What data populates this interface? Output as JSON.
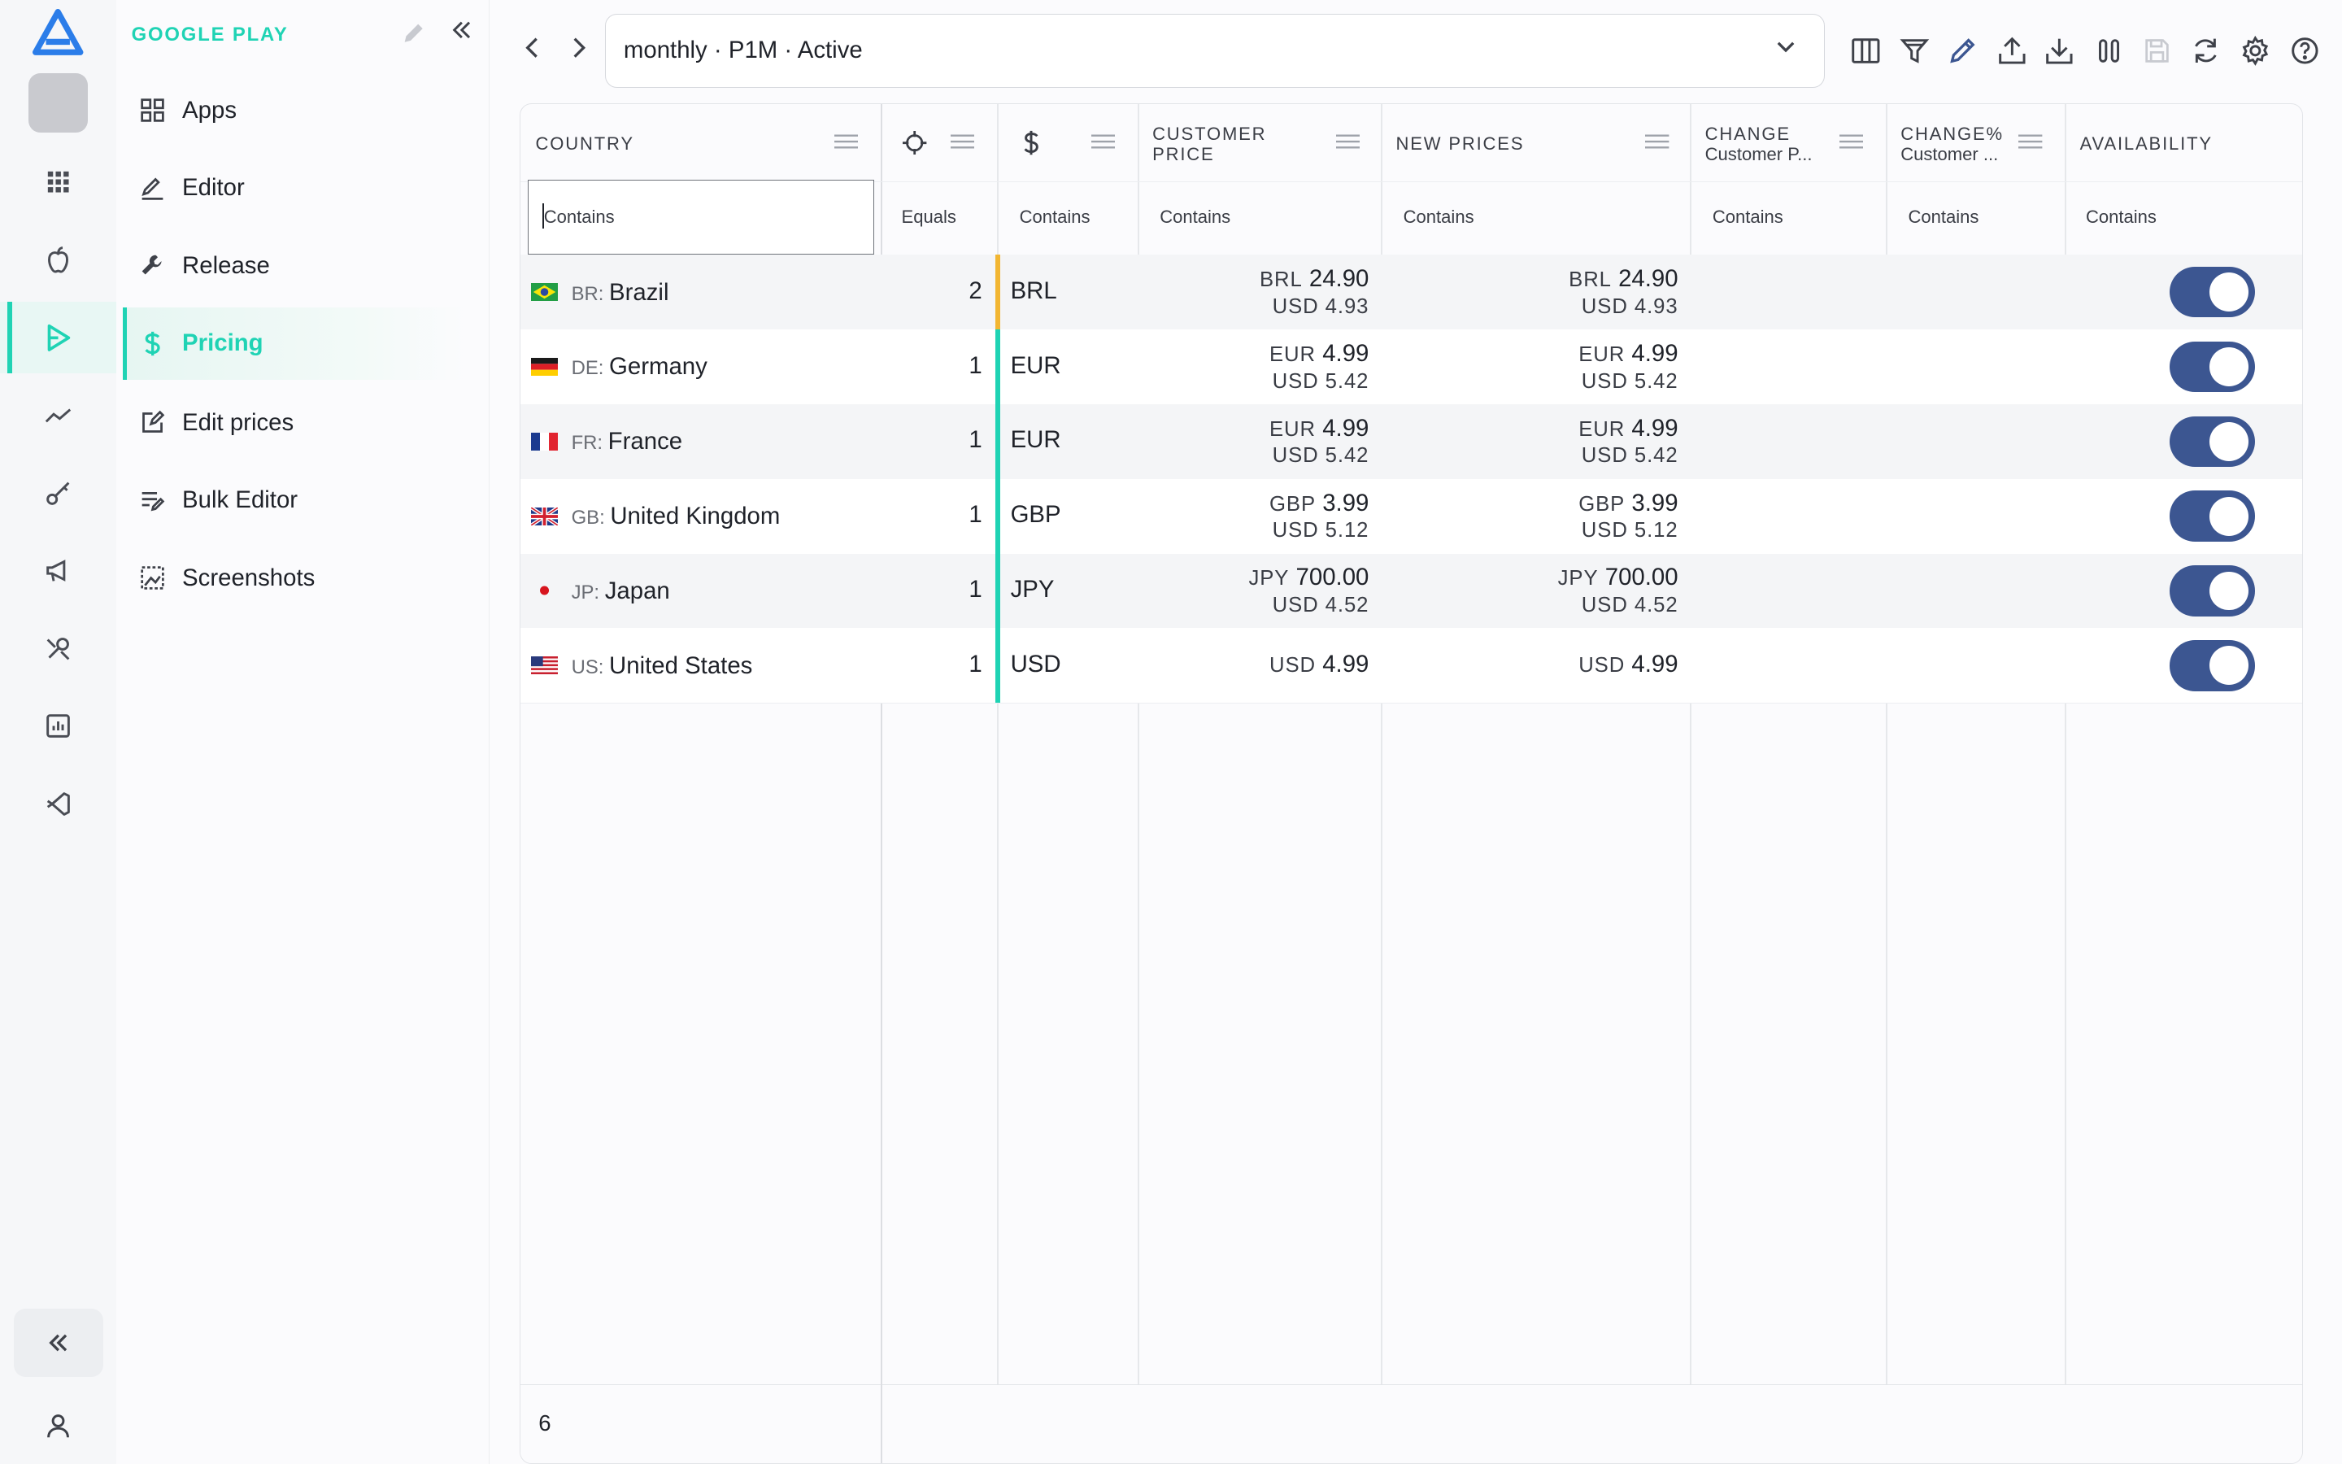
{
  "nav": {
    "section_title": "GOOGLE PLAY",
    "items": [
      {
        "label": "Apps",
        "icon": "grid-icon"
      },
      {
        "label": "Editor",
        "icon": "pen-icon"
      },
      {
        "label": "Release",
        "icon": "wrench-icon"
      },
      {
        "label": "Pricing",
        "icon": "dollar-icon",
        "active": true
      },
      {
        "label": "Edit prices",
        "icon": "edit-square-icon"
      },
      {
        "label": "Bulk Editor",
        "icon": "list-edit-icon"
      },
      {
        "label": "Screenshots",
        "icon": "image-icon"
      }
    ]
  },
  "rail": {
    "icons": [
      "apps-grid-icon",
      "apple-icon",
      "play-icon",
      "trend-icon",
      "key-icon",
      "megaphone-icon",
      "tools-icon",
      "chart-icon",
      "vscode-icon"
    ],
    "active": "play-icon"
  },
  "toolbar": {
    "selector_value": "monthly · P1M · Active",
    "tools": [
      "columns-icon",
      "filter-icon",
      "pencil-icon",
      "upload-icon",
      "download-icon",
      "pause-columns-icon",
      "save-icon",
      "refresh-icon",
      "settings-icon",
      "help-icon"
    ]
  },
  "grid": {
    "columns": {
      "country": "COUNTRY",
      "customer_price_l1": "CUSTOMER",
      "customer_price_l2": "PRICE",
      "new_prices": "NEW PRICES",
      "change_l1": "CHANGE",
      "change_l2": "Customer P...",
      "change_pct_l1": "CHANGE%",
      "change_pct_l2": "Customer ...",
      "availability": "AVAILABILITY"
    },
    "filters": {
      "country": "Contains",
      "count": "Equals",
      "currency": "Contains",
      "customer_price": "Contains",
      "new_prices": "Contains",
      "change": "Contains",
      "change_pct": "Contains",
      "availability": "Contains"
    },
    "rows": [
      {
        "code": "BR:",
        "name": "Brazil",
        "count": "2",
        "currency": "BRL",
        "cp_code": "BRL",
        "cp_amount": "24.90",
        "cp_usd": "USD 4.93",
        "np_code": "BRL",
        "np_amount": "24.90",
        "np_usd": "USD 4.93",
        "available": true,
        "bar_color": "#f2b632"
      },
      {
        "code": "DE:",
        "name": "Germany",
        "count": "1",
        "currency": "EUR",
        "cp_code": "EUR",
        "cp_amount": "4.99",
        "cp_usd": "USD 5.42",
        "np_code": "EUR",
        "np_amount": "4.99",
        "np_usd": "USD 5.42",
        "available": true,
        "bar_color": "#1fd3b4"
      },
      {
        "code": "FR:",
        "name": "France",
        "count": "1",
        "currency": "EUR",
        "cp_code": "EUR",
        "cp_amount": "4.99",
        "cp_usd": "USD 5.42",
        "np_code": "EUR",
        "np_amount": "4.99",
        "np_usd": "USD 5.42",
        "available": true,
        "bar_color": "#1fd3b4"
      },
      {
        "code": "GB:",
        "name": "United Kingdom",
        "count": "1",
        "currency": "GBP",
        "cp_code": "GBP",
        "cp_amount": "3.99",
        "cp_usd": "USD 5.12",
        "np_code": "GBP",
        "np_amount": "3.99",
        "np_usd": "USD 5.12",
        "available": true,
        "bar_color": "#1fd3b4"
      },
      {
        "code": "JP:",
        "name": "Japan",
        "count": "1",
        "currency": "JPY",
        "cp_code": "JPY",
        "cp_amount": "700.00",
        "cp_usd": "USD 4.52",
        "np_code": "JPY",
        "np_amount": "700.00",
        "np_usd": "USD 4.52",
        "available": true,
        "bar_color": "#1fd3b4"
      },
      {
        "code": "US:",
        "name": "United States",
        "count": "1",
        "currency": "USD",
        "cp_code": "USD",
        "cp_amount": "4.99",
        "cp_usd": "",
        "np_code": "USD",
        "np_amount": "4.99",
        "np_usd": "",
        "available": true,
        "bar_color": "#1fd3b4"
      }
    ],
    "footer_count": "6"
  },
  "colors": {
    "accent": "#1fd3b4",
    "toggle_on": "#3c5691",
    "count_bar_multi": "#f2b632"
  }
}
